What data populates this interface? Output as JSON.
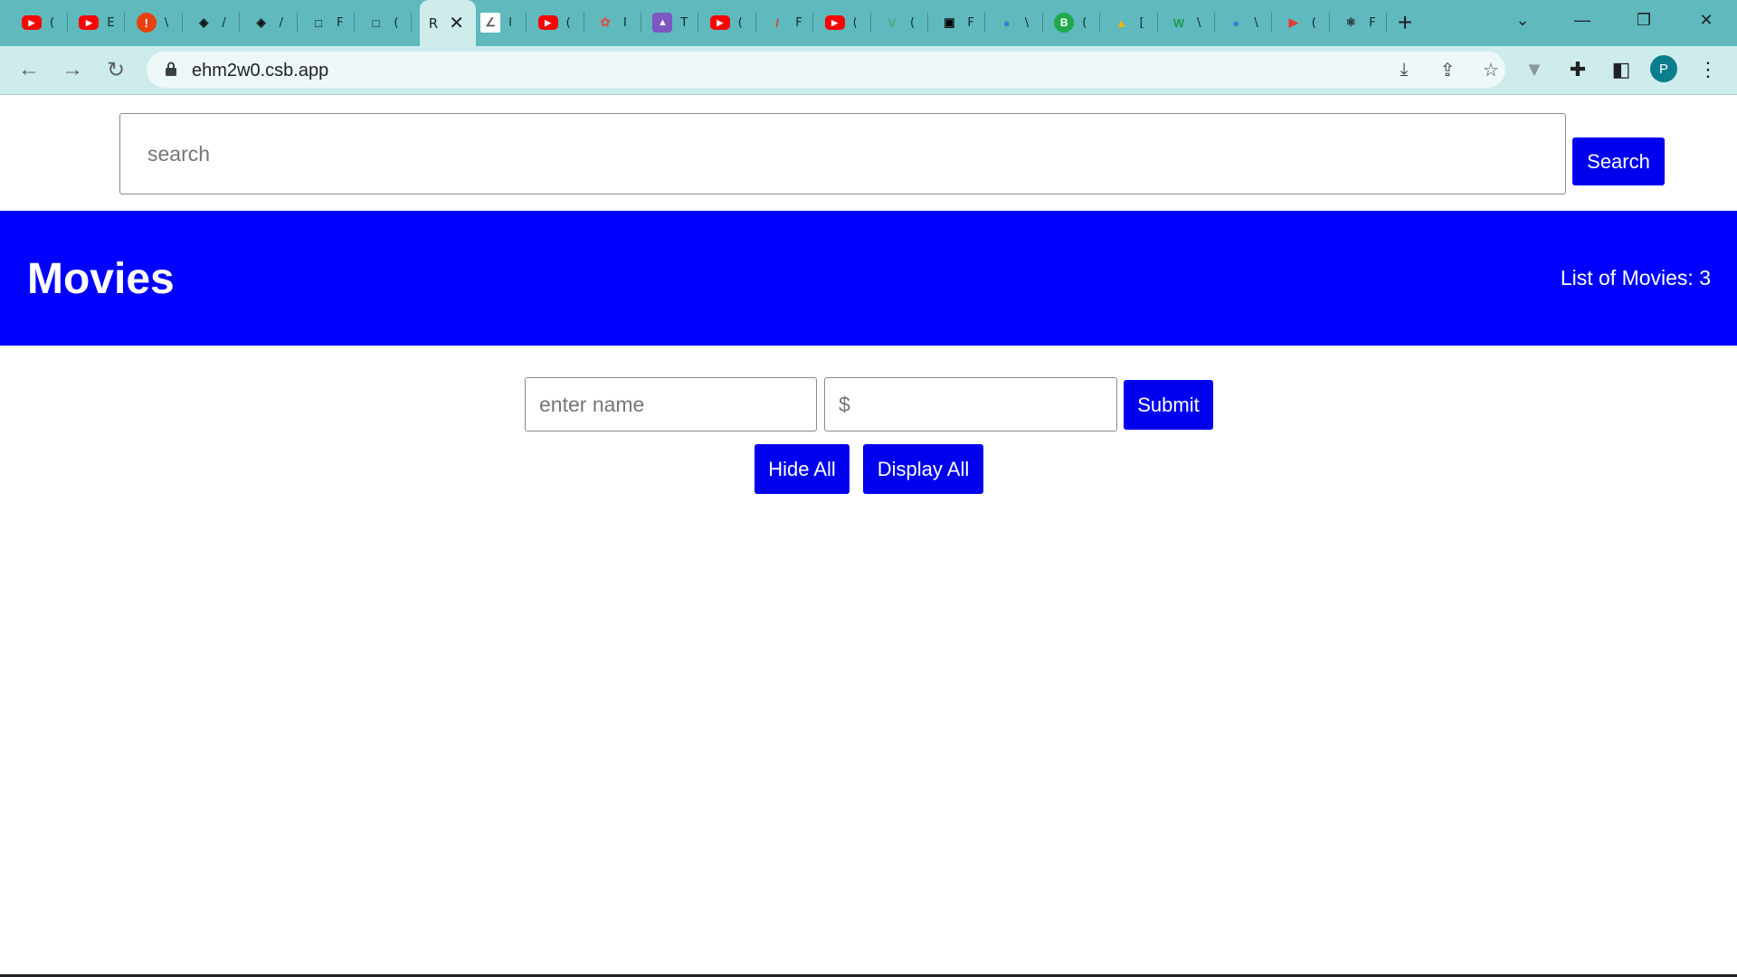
{
  "browser": {
    "tabs": [
      {
        "icon": "youtube-icon",
        "color": "#ff0000",
        "glyph": "▶",
        "title": "("
      },
      {
        "icon": "youtube-icon",
        "color": "#ff0000",
        "glyph": "▶",
        "title": "E"
      },
      {
        "icon": "alert-icon",
        "color": "#e8400e",
        "glyph": "!",
        "title": "\\"
      },
      {
        "icon": "codepen-icon",
        "color": "#111111",
        "glyph": "◈",
        "title": "/"
      },
      {
        "icon": "codepen-icon",
        "color": "#111111",
        "glyph": "◈",
        "title": "/"
      },
      {
        "icon": "square-icon",
        "color": "#111111",
        "glyph": "□",
        "title": "F"
      },
      {
        "icon": "square-icon",
        "color": "#111111",
        "glyph": "□",
        "title": "("
      }
    ],
    "active_tab": {
      "title": "R",
      "close": "✕"
    },
    "tabs_after": [
      {
        "icon": "page-icon",
        "color": "#ffffff",
        "glyph": "∠",
        "title": "l"
      },
      {
        "icon": "youtube-icon",
        "color": "#ff0000",
        "glyph": "▶",
        "title": "("
      },
      {
        "icon": "openai-icon",
        "color": "#d4574e",
        "glyph": "✿",
        "title": "I"
      },
      {
        "icon": "rocket-icon",
        "color": "#7e57c2",
        "glyph": "▲",
        "title": "T"
      },
      {
        "icon": "youtube-icon",
        "color": "#ff0000",
        "glyph": "▶",
        "title": "("
      },
      {
        "icon": "pen-icon",
        "color": "#e53935",
        "glyph": "/",
        "title": "F"
      },
      {
        "icon": "youtube-icon",
        "color": "#ff0000",
        "glyph": "▶",
        "title": "("
      },
      {
        "icon": "vue-icon",
        "color": "#3fb27f",
        "glyph": "V",
        "title": "("
      },
      {
        "icon": "square-icon",
        "color": "#000000",
        "glyph": "▣",
        "title": "F"
      },
      {
        "icon": "globe-icon",
        "color": "#3a7bd5",
        "glyph": "●",
        "title": "\\"
      },
      {
        "icon": "b-icon",
        "color": "#22a94f",
        "glyph": "B",
        "title": "("
      },
      {
        "icon": "drive-icon",
        "color": "#f4b400",
        "glyph": "▲",
        "title": "["
      },
      {
        "icon": "w-icon",
        "color": "#1e9a52",
        "glyph": "W",
        "title": "\\"
      },
      {
        "icon": "globe-icon",
        "color": "#3a7bd5",
        "glyph": "●",
        "title": "\\"
      },
      {
        "icon": "flag-icon",
        "color": "#e53935",
        "glyph": "▶",
        "title": "("
      },
      {
        "icon": "react-icon",
        "color": "#1e2a2c",
        "glyph": "⚛",
        "title": "F"
      }
    ],
    "new_tab": "+",
    "url": "ehm2w0.csb.app",
    "profile_initial": "P"
  },
  "search": {
    "placeholder": "search",
    "button_label": "Search"
  },
  "banner": {
    "title": "Movies",
    "count_label": "List of Movies:",
    "count_value": "3"
  },
  "form": {
    "name_placeholder": "enter name",
    "price_placeholder": "$",
    "submit_label": "Submit",
    "hide_label": "Hide All",
    "display_label": "Display All"
  },
  "colors": {
    "accent": "#0000ff",
    "button": "#0000ee",
    "tabstrip": "#5fb9bd",
    "toolbar": "#cfeced"
  }
}
